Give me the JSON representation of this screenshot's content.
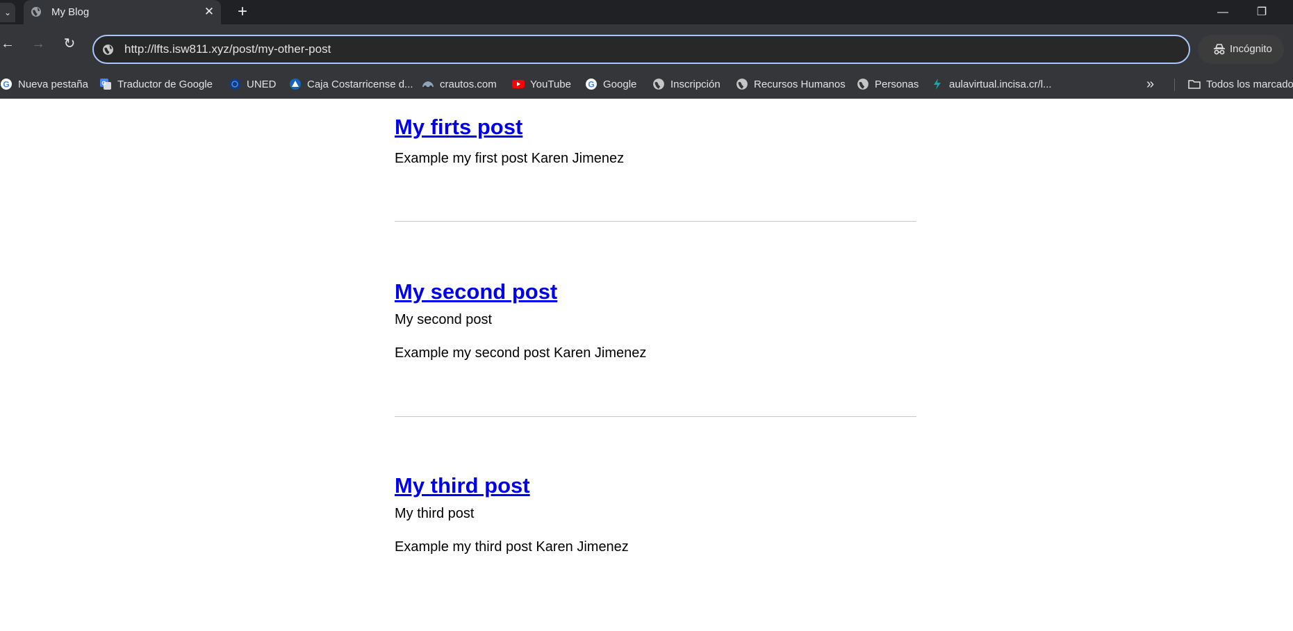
{
  "browser": {
    "tab": {
      "title": "My Blog"
    },
    "new_tab_symbol": "+",
    "window_controls": {
      "minimize": "—",
      "restore": "❐"
    },
    "address_bar": {
      "url": "http://lfts.isw811.xyz/post/my-other-post"
    },
    "incognito_label": "Incógnito",
    "bookmarks": [
      {
        "label": "Nueva pestaña",
        "icon": "google-icon"
      },
      {
        "label": "Traductor de Google",
        "icon": "google-translate-icon"
      },
      {
        "label": "UNED",
        "icon": "uned-icon"
      },
      {
        "label": "Caja Costarricense d...",
        "icon": "ccss-icon"
      },
      {
        "label": "crautos.com",
        "icon": "crautos-icon"
      },
      {
        "label": "YouTube",
        "icon": "youtube-icon"
      },
      {
        "label": "Google",
        "icon": "google-icon"
      },
      {
        "label": "Inscripción",
        "icon": "globe-icon"
      },
      {
        "label": "Recursos Humanos",
        "icon": "globe-icon"
      },
      {
        "label": "Personas",
        "icon": "globe-icon"
      },
      {
        "label": "aulavirtual.incisa.cr/l...",
        "icon": "aulavirtual-icon"
      }
    ],
    "bookmarks_more": "»",
    "all_bookmarks_label": "Todos los marcado"
  },
  "posts": [
    {
      "title": "My firts post",
      "excerpt": "",
      "body": "Example my first post Karen Jimenez"
    },
    {
      "title": "My second post",
      "excerpt": "My second post",
      "body": "Example my second post Karen Jimenez"
    },
    {
      "title": "My third post",
      "excerpt": "My third post",
      "body": "Example my third post Karen Jimenez"
    }
  ],
  "colors": {
    "link": "#0000ee",
    "chrome_dark": "#202124",
    "toolbar": "#35363a",
    "focus_ring": "#a8c7fa"
  }
}
